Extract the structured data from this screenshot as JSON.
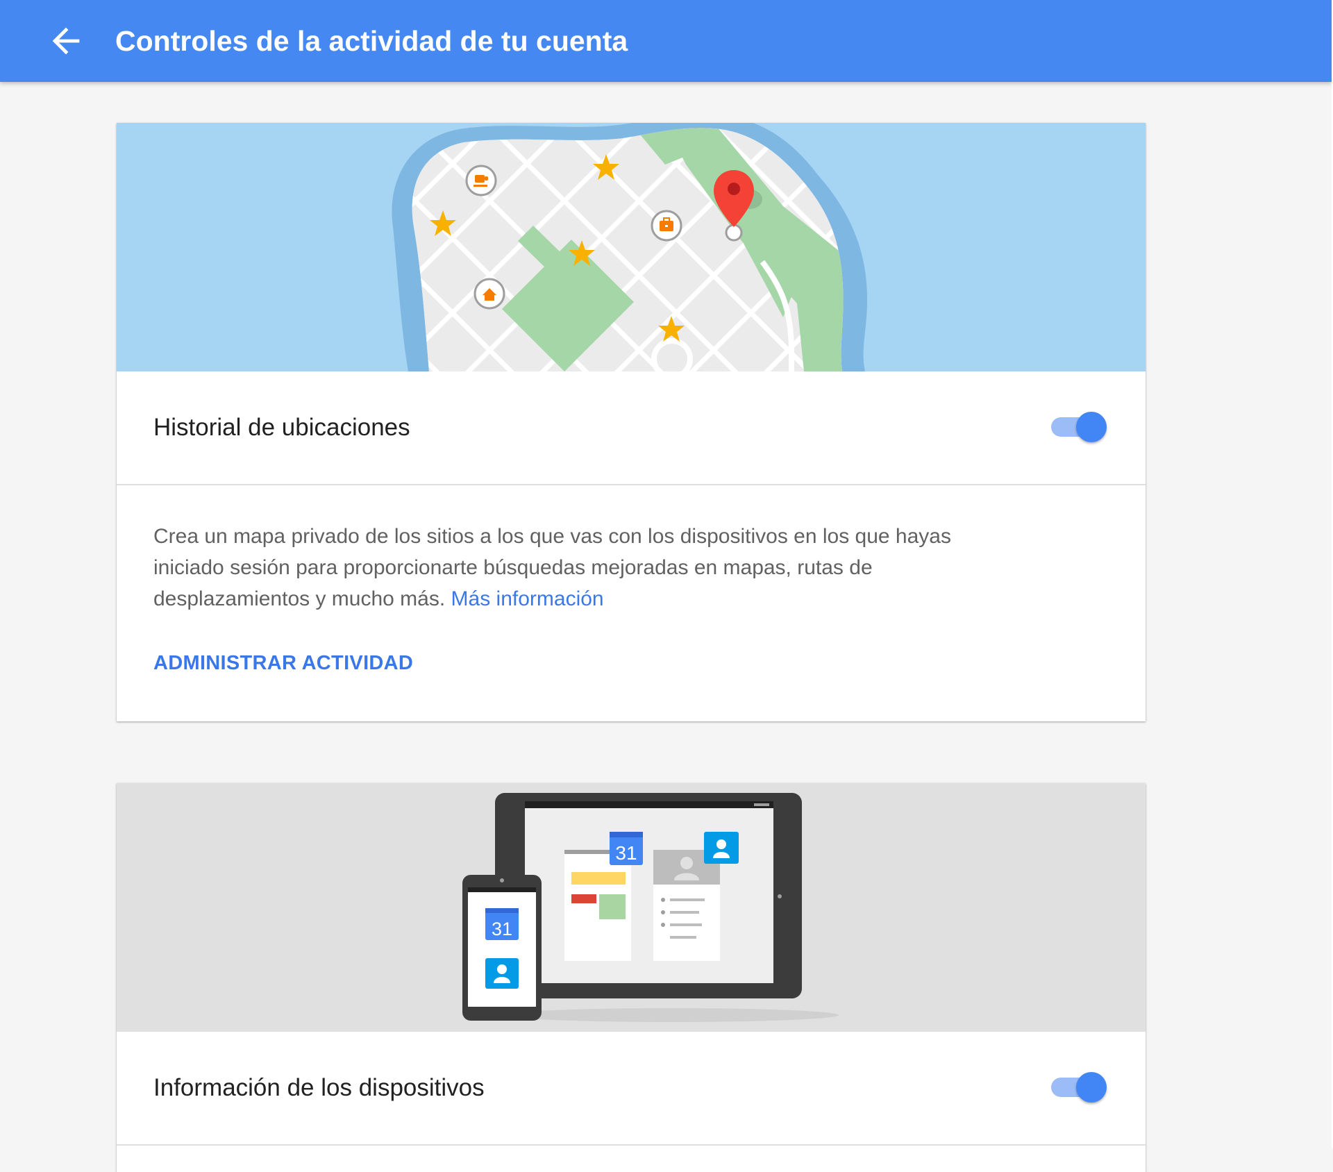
{
  "header": {
    "title": "Controles de la actividad de tu cuenta",
    "back_icon": "arrow-back-icon"
  },
  "colors": {
    "header_bg": "#4688f1",
    "accent": "#4285f4",
    "link": "#3b78e7",
    "page_bg": "#f5f5f5"
  },
  "cards": [
    {
      "title": "Historial de ubicaciones",
      "toggle_on": true,
      "illustration": "map-illustration",
      "description": "Crea un mapa privado de los sitios a los que vas con los dispositivos en los que hayas iniciado sesión para proporcionarte búsquedas mejoradas en mapas, rutas de desplazamientos y mucho más.",
      "learn_more": "Más información",
      "manage_label": "ADMINISTRAR ACTIVIDAD"
    },
    {
      "title": "Información de los dispositivos",
      "toggle_on": true,
      "illustration": "devices-illustration",
      "calendar_number": "31"
    }
  ]
}
